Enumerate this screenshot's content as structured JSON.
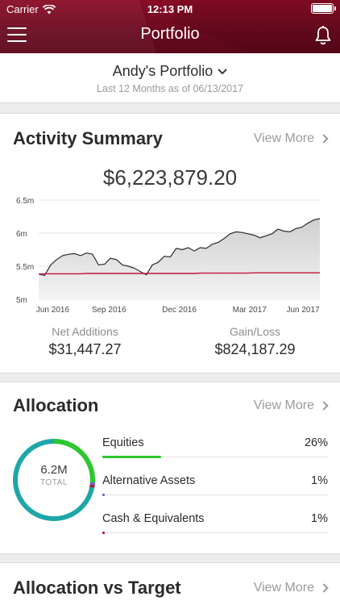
{
  "status": {
    "carrier": "Carrier",
    "time": "12:13 PM"
  },
  "nav": {
    "title": "Portfolio"
  },
  "portfolio": {
    "name": "Andy's Portfolio",
    "subtitle": "Last 12 Months as of 06/13/2017"
  },
  "activity": {
    "title": "Activity Summary",
    "view_more": "View More",
    "total": "$6,223,879.20",
    "net_additions_label": "Net Additions",
    "net_additions_value": "$31,447.27",
    "gain_loss_label": "Gain/Loss",
    "gain_loss_value": "$824,187.29"
  },
  "allocation": {
    "title": "Allocation",
    "view_more": "View More",
    "donut_value": "6.2M",
    "donut_label": "TOTAL",
    "items": [
      {
        "name": "Equities",
        "percent": "26%",
        "fraction": 0.26,
        "color": "#2ec82e"
      },
      {
        "name": "Alternative Assets",
        "percent": "1%",
        "fraction": 0.01,
        "color": "#7b5cc8"
      },
      {
        "name": "Cash & Equivalents",
        "percent": "1%",
        "fraction": 0.01,
        "color": "#b0142e"
      }
    ]
  },
  "allocation_target": {
    "title": "Allocation vs Target",
    "view_more": "View More"
  },
  "colors": {
    "brand": "#7a0b23",
    "teal": "#1fa6a6",
    "green": "#2ec82e",
    "red_line": "#c0143c"
  },
  "chart_data": {
    "type": "area",
    "yticks": [
      "6.5m",
      "6m",
      "5.5m",
      "5m"
    ],
    "ytick_values": [
      6.5,
      6.0,
      5.5,
      5.0
    ],
    "ylim": [
      5.0,
      6.5
    ],
    "xticks": [
      "Jun 2016",
      "Sep 2016",
      "Dec 2016",
      "Mar 2017",
      "Jun 2017"
    ],
    "xtick_positions": [
      0.05,
      0.25,
      0.5,
      0.75,
      0.94
    ],
    "series": [
      {
        "values": [
          5.38,
          5.36,
          5.52,
          5.6,
          5.66,
          5.68,
          5.69,
          5.66,
          5.7,
          5.68,
          5.52,
          5.53,
          5.62,
          5.6,
          5.52,
          5.5,
          5.47,
          5.42,
          5.37,
          5.52,
          5.56,
          5.65,
          5.64,
          5.77,
          5.75,
          5.78,
          5.73,
          5.78,
          5.77,
          5.83,
          5.86,
          5.92,
          5.99,
          6.02,
          6.01,
          5.99,
          5.97,
          5.93,
          5.96,
          5.99,
          6.06,
          6.03,
          6.02,
          6.07,
          6.09,
          6.15,
          6.2,
          6.22
        ]
      },
      {
        "values": [
          5.38,
          5.385,
          5.385,
          5.385,
          5.385,
          5.385,
          5.385,
          5.385,
          5.39,
          5.39,
          5.39,
          5.39,
          5.39,
          5.39,
          5.39,
          5.39,
          5.39,
          5.39,
          5.39,
          5.39,
          5.39,
          5.39,
          5.39,
          5.39,
          5.39,
          5.39,
          5.39,
          5.395,
          5.395,
          5.395,
          5.395,
          5.395,
          5.395,
          5.395,
          5.395,
          5.395,
          5.4,
          5.4,
          5.4,
          5.4,
          5.4,
          5.4,
          5.4,
          5.4,
          5.4,
          5.4,
          5.4,
          5.4
        ]
      }
    ]
  }
}
